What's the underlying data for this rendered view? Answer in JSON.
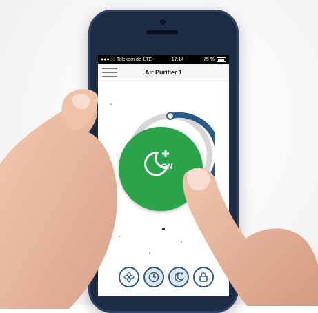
{
  "status": {
    "carrier": "●●●○○ Telekom.de",
    "network": "LTE",
    "time": "17:14",
    "battery": "75 %"
  },
  "header": {
    "title": "Air Purifier 1"
  },
  "power": {
    "state_label": "ON",
    "icon": "moon-plus-icon"
  },
  "modes": [
    {
      "name": "auto",
      "icon": "fan-icon"
    },
    {
      "name": "timer",
      "icon": "clock-icon"
    },
    {
      "name": "night",
      "icon": "moon-icon"
    },
    {
      "name": "lock",
      "icon": "lock-icon"
    }
  ],
  "colors": {
    "accent": "#2aa34a",
    "ring": "#2a5a88"
  }
}
